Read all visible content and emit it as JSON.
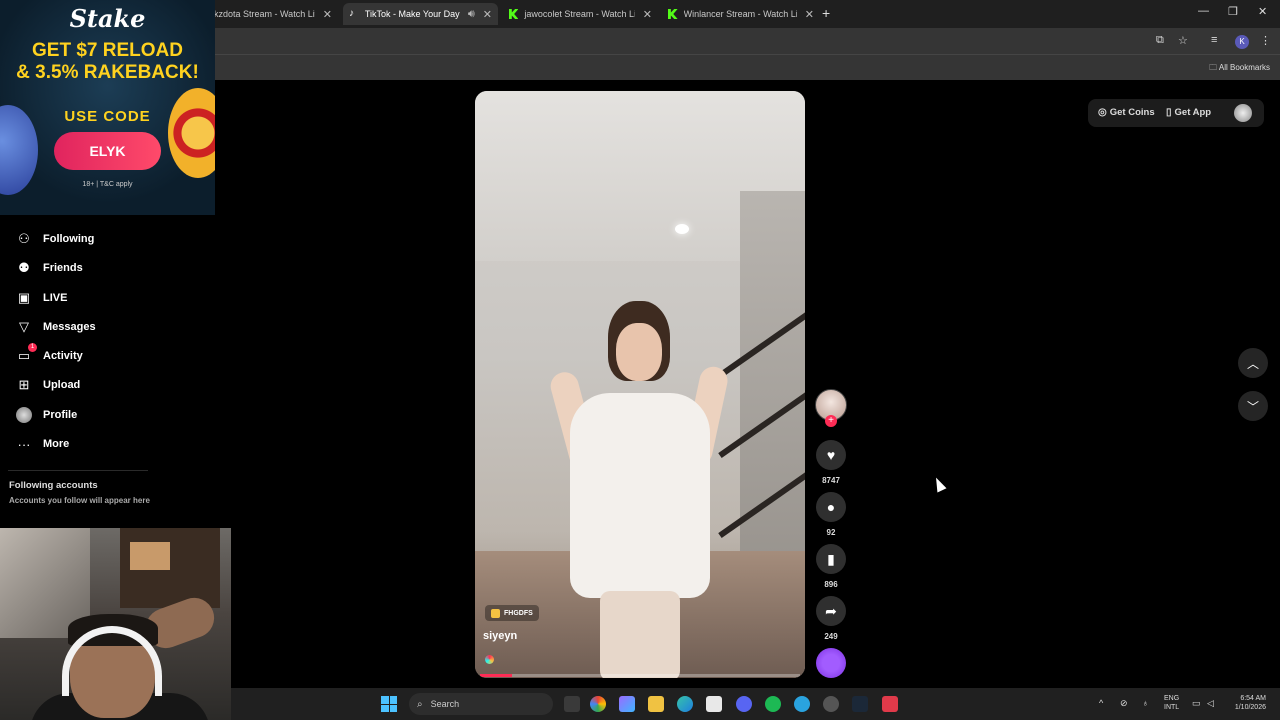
{
  "browser": {
    "tabs": [
      {
        "title": "kzdota Stream - Watch Live",
        "icon": "kick-icon",
        "active": false
      },
      {
        "title": "TikTok - Make Your Day",
        "icon": "tiktok-icon",
        "active": true
      },
      {
        "title": "jawocolet Stream - Watch Live",
        "icon": "kick-icon",
        "active": false
      },
      {
        "title": "Winlancer Stream - Watch Live",
        "icon": "kick-icon",
        "active": false
      }
    ],
    "profile_initial": "K",
    "all_bookmarks": "All Bookmarks"
  },
  "ad": {
    "brand": "Stake",
    "headline_1": "GET $7 RELOAD",
    "headline_2": "& 3.5% RAKEBACK!",
    "use_code": "USE CODE",
    "code": "ELYK",
    "terms": "18+ | T&C apply"
  },
  "sidebar": {
    "items": [
      {
        "label": "Following",
        "icon": "following-icon"
      },
      {
        "label": "Friends",
        "icon": "friends-icon"
      },
      {
        "label": "LIVE",
        "icon": "live-icon"
      },
      {
        "label": "Messages",
        "icon": "messages-icon"
      },
      {
        "label": "Activity",
        "icon": "activity-icon",
        "badge": "1"
      },
      {
        "label": "Upload",
        "icon": "upload-icon"
      },
      {
        "label": "Profile",
        "icon": "avatar"
      },
      {
        "label": "More",
        "icon": "more-icon"
      }
    ],
    "following_accounts_title": "Following accounts",
    "following_accounts_sub": "Accounts you follow will appear here"
  },
  "header": {
    "get_coins": "Get Coins",
    "get_app": "Get App"
  },
  "video": {
    "tag": "FHGDFS",
    "username": "siyeyn",
    "progress_fraction": 0.1
  },
  "actions": {
    "likes": "8747",
    "comments": "92",
    "saves": "896",
    "shares": "249"
  },
  "taskbar": {
    "search_label": "Search",
    "lang_1": "ENG",
    "lang_2": "INTL",
    "time": "6:54 AM",
    "date": "1/10/2026"
  },
  "colors": {
    "accent": "#fe2c55",
    "ad_yellow": "#ffd21f"
  }
}
